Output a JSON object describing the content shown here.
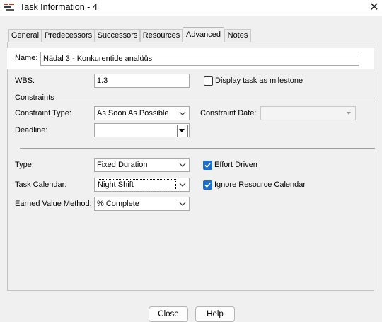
{
  "window": {
    "title": "Task Information - 4",
    "icon": "project-app-icon"
  },
  "tabs": [
    {
      "label": "General",
      "active": false
    },
    {
      "label": "Predecessors",
      "active": false
    },
    {
      "label": "Successors",
      "active": false
    },
    {
      "label": "Resources",
      "active": false
    },
    {
      "label": "Advanced",
      "active": true
    },
    {
      "label": "Notes",
      "active": false
    }
  ],
  "form": {
    "name_label": "Name:",
    "name_value": "Nädal 3 - Konkurentide analüüs",
    "wbs_label": "WBS:",
    "wbs_value": "1.3",
    "milestone_label": "Display task as milestone",
    "milestone_checked": false,
    "constraints_header": "Constraints",
    "constraint_type_label": "Constraint Type:",
    "constraint_type_value": "As Soon As Possible",
    "constraint_date_label": "Constraint Date:",
    "constraint_date_value": "",
    "deadline_label": "Deadline:",
    "deadline_value": "",
    "type_label": "Type:",
    "type_value": "Fixed Duration",
    "effort_driven_label": "Effort Driven",
    "effort_driven_checked": true,
    "task_calendar_label": "Task Calendar:",
    "task_calendar_value": "Night Shift",
    "ignore_resource_calendar_label": "Ignore Resource Calendar",
    "ignore_resource_calendar_checked": true,
    "earned_value_label": "Earned Value Method:",
    "earned_value_value": "% Complete"
  },
  "buttons": {
    "close": "Close",
    "help": "Help"
  },
  "colors": {
    "checkbox_checked": "#1a6fd1",
    "background": "#f0f0f0",
    "title_bar": "#ffffff"
  }
}
